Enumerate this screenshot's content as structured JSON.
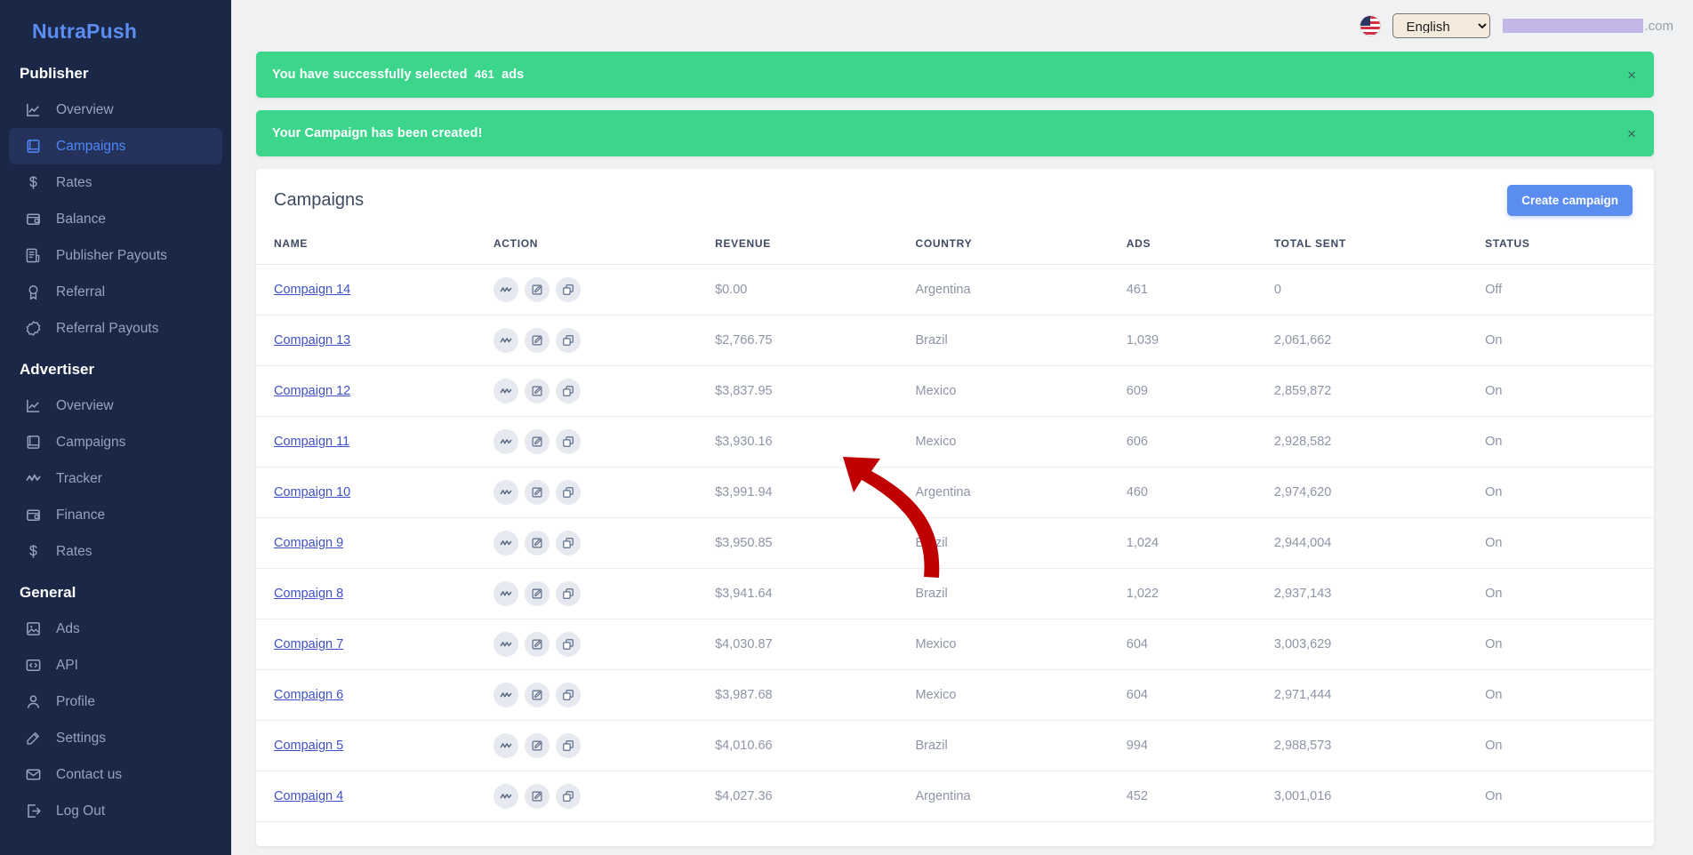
{
  "brand": {
    "name": "NutraPush"
  },
  "sidebar": {
    "sections": [
      {
        "title": "Publisher",
        "items": [
          {
            "label": "Overview",
            "icon": "chart-line-icon",
            "active": false
          },
          {
            "label": "Campaigns",
            "icon": "book-icon",
            "active": true
          },
          {
            "label": "Rates",
            "icon": "dollar-icon",
            "active": false
          },
          {
            "label": "Balance",
            "icon": "wallet-icon",
            "active": false
          },
          {
            "label": "Publisher Payouts",
            "icon": "receipt-icon",
            "active": false
          },
          {
            "label": "Referral",
            "icon": "medal-icon",
            "active": false
          },
          {
            "label": "Referral Payouts",
            "icon": "badge-icon",
            "active": false
          }
        ]
      },
      {
        "title": "Advertiser",
        "items": [
          {
            "label": "Overview",
            "icon": "chart-line-icon",
            "active": false
          },
          {
            "label": "Campaigns",
            "icon": "book-icon",
            "active": false
          },
          {
            "label": "Tracker",
            "icon": "activity-icon",
            "active": false
          },
          {
            "label": "Finance",
            "icon": "wallet-icon",
            "active": false
          },
          {
            "label": "Rates",
            "icon": "dollar-icon",
            "active": false
          }
        ]
      },
      {
        "title": "General",
        "items": [
          {
            "label": "Ads",
            "icon": "image-icon",
            "active": false
          },
          {
            "label": "API",
            "icon": "code-icon",
            "active": false
          },
          {
            "label": "Profile",
            "icon": "user-icon",
            "active": false
          },
          {
            "label": "Settings",
            "icon": "edit-icon",
            "active": false
          },
          {
            "label": "Contact us",
            "icon": "mail-icon",
            "active": false
          },
          {
            "label": "Log Out",
            "icon": "logout-icon",
            "active": false
          }
        ]
      }
    ]
  },
  "topbar": {
    "flag": "us-flag-icon",
    "language_selected": "English",
    "language_options": [
      "English"
    ],
    "account_domain_suffix": ".com"
  },
  "alerts": [
    {
      "message_prefix": "You have successfully selected",
      "count": "461",
      "message_suffix": "ads",
      "close": "×"
    },
    {
      "message": "Your Campaign has been created!",
      "close": "×"
    }
  ],
  "card": {
    "title": "Campaigns",
    "create_button": "Create campaign",
    "columns": [
      "NAME",
      "ACTION",
      "REVENUE",
      "COUNTRY",
      "ADS",
      "TOTAL SENT",
      "STATUS"
    ],
    "row_actions": [
      "tracker-icon",
      "edit-icon",
      "duplicate-icon"
    ],
    "rows": [
      {
        "name": "Compaign 14",
        "revenue": "$0.00",
        "country": "Argentina",
        "ads": "461",
        "total_sent": "0",
        "status": "Off"
      },
      {
        "name": "Compaign 13",
        "revenue": "$2,766.75",
        "country": "Brazil",
        "ads": "1,039",
        "total_sent": "2,061,662",
        "status": "On"
      },
      {
        "name": "Compaign 12",
        "revenue": "$3,837.95",
        "country": "Mexico",
        "ads": "609",
        "total_sent": "2,859,872",
        "status": "On"
      },
      {
        "name": "Compaign 11",
        "revenue": "$3,930.16",
        "country": "Mexico",
        "ads": "606",
        "total_sent": "2,928,582",
        "status": "On"
      },
      {
        "name": "Compaign 10",
        "revenue": "$3,991.94",
        "country": "Argentina",
        "ads": "460",
        "total_sent": "2,974,620",
        "status": "On"
      },
      {
        "name": "Compaign 9",
        "revenue": "$3,950.85",
        "country": "Brazil",
        "ads": "1,024",
        "total_sent": "2,944,004",
        "status": "On"
      },
      {
        "name": "Compaign 8",
        "revenue": "$3,941.64",
        "country": "Brazil",
        "ads": "1,022",
        "total_sent": "2,937,143",
        "status": "On"
      },
      {
        "name": "Compaign 7",
        "revenue": "$4,030.87",
        "country": "Mexico",
        "ads": "604",
        "total_sent": "3,003,629",
        "status": "On"
      },
      {
        "name": "Compaign 6",
        "revenue": "$3,987.68",
        "country": "Mexico",
        "ads": "604",
        "total_sent": "2,971,444",
        "status": "On"
      },
      {
        "name": "Compaign 5",
        "revenue": "$4,010.66",
        "country": "Brazil",
        "ads": "994",
        "total_sent": "2,988,573",
        "status": "On"
      },
      {
        "name": "Compaign 4",
        "revenue": "$4,027.36",
        "country": "Argentina",
        "ads": "452",
        "total_sent": "3,001,016",
        "status": "On"
      }
    ]
  },
  "annotation": {
    "type": "red-curved-arrow",
    "color": "#c00000",
    "points_at": "duplicate-icon-row-1"
  },
  "colors": {
    "sidebar_bg": "#1b2746",
    "accent_blue": "#5b8cf0",
    "alert_green": "#3bd68c",
    "link_blue": "#3f51c6",
    "page_bg": "#eff1f3"
  }
}
